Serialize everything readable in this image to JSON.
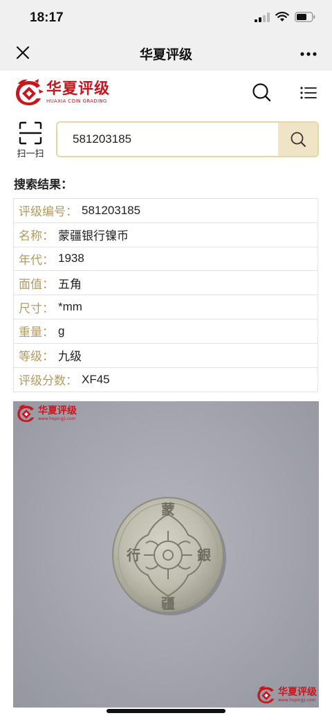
{
  "status_bar": {
    "time": "18:17"
  },
  "wechat_nav": {
    "title": "华夏评级"
  },
  "site": {
    "logo_cn": "华夏评级",
    "logo_en": "HUAXIA COIN GRADING"
  },
  "search": {
    "scan_label": "扫一扫",
    "value": "581203185"
  },
  "results": {
    "title": "搜索结果：",
    "rows": [
      {
        "label": "评级编号：",
        "value": "581203185"
      },
      {
        "label": "名称：",
        "value": "蒙疆银行镍币"
      },
      {
        "label": "年代：",
        "value": "1938"
      },
      {
        "label": "面值：",
        "value": "五角"
      },
      {
        "label": "尺寸：",
        "value": "*mm"
      },
      {
        "label": "重量：",
        "value": "g"
      },
      {
        "label": "等级：",
        "value": "九级"
      },
      {
        "label": "评级分数：",
        "value": "XF45"
      }
    ]
  },
  "photo": {
    "watermark_cn": "华夏评级",
    "watermark_url": "www.hxpingji.com",
    "coin_chars": {
      "top": "蒙",
      "bottom": "疆",
      "left": "行",
      "right": "銀"
    }
  },
  "colors": {
    "brand_red": "#c8161d",
    "label_gold": "#b49a5e",
    "search_border": "#e4d6a8",
    "search_button": "#efe5c6"
  }
}
